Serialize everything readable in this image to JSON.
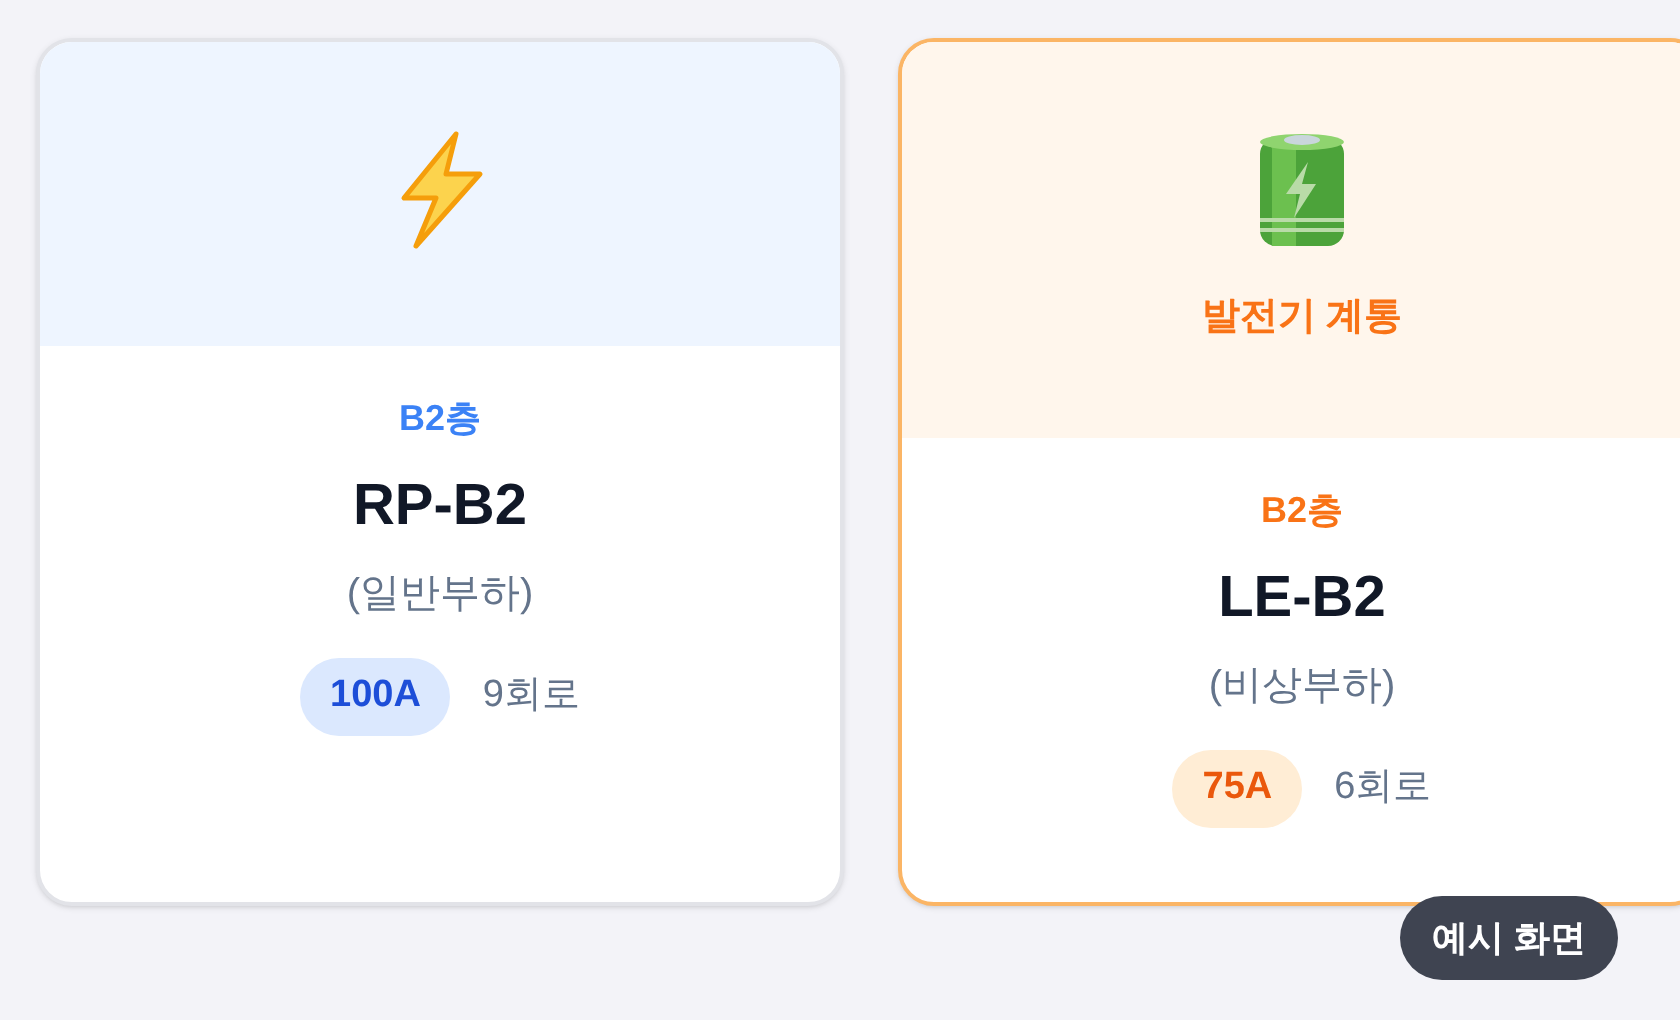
{
  "panels": [
    {
      "kind": "normal",
      "floor": "B2층",
      "name": "RP-B2",
      "load": "(일반부하)",
      "rating": "100A",
      "circuits": "9회로"
    },
    {
      "kind": "emergency",
      "system_label": "발전기 계통",
      "floor": "B2층",
      "name": "LE-B2",
      "load": "(비상부하)",
      "rating": "75A",
      "circuits": "6회로"
    }
  ],
  "badge": "예시 화면"
}
